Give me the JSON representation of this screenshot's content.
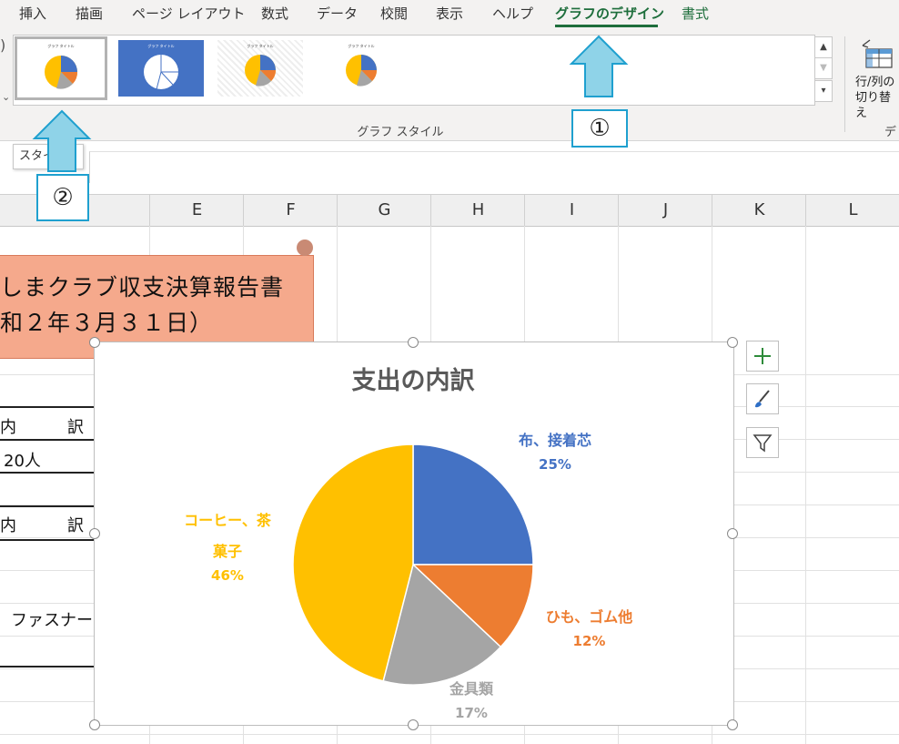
{
  "ribbon": {
    "tabs": [
      {
        "label": "挿入"
      },
      {
        "label": "描画"
      },
      {
        "label": "ページ レイアウト"
      },
      {
        "label": "数式"
      },
      {
        "label": "データ"
      },
      {
        "label": "校閲"
      },
      {
        "label": "表示"
      },
      {
        "label": "ヘルプ"
      },
      {
        "label": "グラフのデザイン",
        "active": true
      },
      {
        "label": "書式"
      }
    ],
    "gallery_group_label": "グラフ スタイル",
    "switch_button_label_1": "行/列の",
    "switch_button_label_2": "切り替え",
    "data_group_label_partial": "デ",
    "thumbnail_title": "グラフ タイトル"
  },
  "annotations": {
    "callout_1": "①",
    "callout_2": "②",
    "arrow_color": "#8fd3e8"
  },
  "tooltip": "スタイ",
  "columns": [
    "E",
    "F",
    "G",
    "H",
    "I",
    "J",
    "K",
    "L"
  ],
  "sheet": {
    "banner_line1": "しまクラブ収支決算報告書",
    "banner_line2": "和２年３月３１日）",
    "cells": {
      "r1_a": "内",
      "r1_b": "訳",
      "r2": "20人",
      "r3_a": "内",
      "r3_b": "訳",
      "r4": "ファスナー"
    }
  },
  "chart_data": {
    "type": "pie",
    "title": "支出の内訳",
    "slices": [
      {
        "label": "布、接着芯",
        "percent": 25,
        "color": "#4472c4"
      },
      {
        "label": "ひも、ゴム他",
        "percent": 12,
        "color": "#ed7d31"
      },
      {
        "label": "金具類",
        "percent": 17,
        "color": "#a5a5a5"
      },
      {
        "label": "コーヒー、茶菓子",
        "percent": 46,
        "color": "#ffc000"
      }
    ],
    "label_display": {
      "s0_name": "布、接着芯",
      "s0_pct": "25%",
      "s1_name": "ひも、ゴム他",
      "s1_pct": "12%",
      "s2_name": "金具類",
      "s2_pct": "17%",
      "s3_name_1": "コーヒー、茶",
      "s3_name_2": "菓子",
      "s3_pct": "46%"
    }
  }
}
